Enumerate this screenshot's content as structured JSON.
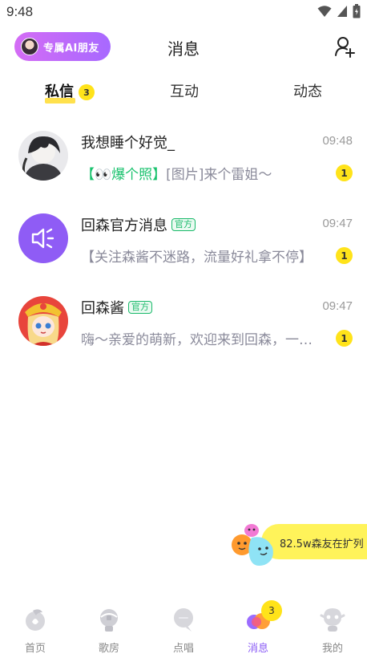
{
  "status_bar": {
    "time": "9:48"
  },
  "header": {
    "ai_button_label": "专属AI朋友",
    "title": "消息"
  },
  "tabs": [
    {
      "label": "私信",
      "badge": "3"
    },
    {
      "label": "互动"
    },
    {
      "label": "动态"
    }
  ],
  "messages": [
    {
      "name": "我想睡个好觉_",
      "time": "09:48",
      "preview_highlight": "【👀爆个照】",
      "preview_rest": "[图片]来个雷姐～",
      "unread": "1"
    },
    {
      "name": "回森官方消息",
      "tag": "官方",
      "time": "09:47",
      "preview_rest": "【关注森酱不迷路，流量好礼拿不停】",
      "unread": "1"
    },
    {
      "name": "回森酱",
      "tag": "官方",
      "time": "09:47",
      "preview_rest": "嗨～亲爱的萌新，欢迎来到回森，一起来唱歌吧",
      "unread": "1"
    }
  ],
  "floating_banner": {
    "text": "82.5w森友在扩列"
  },
  "bottom_nav": [
    {
      "label": "首页",
      "icon": "home-icon"
    },
    {
      "label": "歌房",
      "icon": "song-room-icon"
    },
    {
      "label": "点唱",
      "icon": "request-song-icon"
    },
    {
      "label": "消息",
      "icon": "message-icon",
      "badge": "3",
      "active": true
    },
    {
      "label": "我的",
      "icon": "profile-icon"
    }
  ],
  "colors": {
    "accent_yellow": "#ffe31a",
    "accent_purple": "#8b5cf6",
    "official_green": "#19b96a"
  }
}
